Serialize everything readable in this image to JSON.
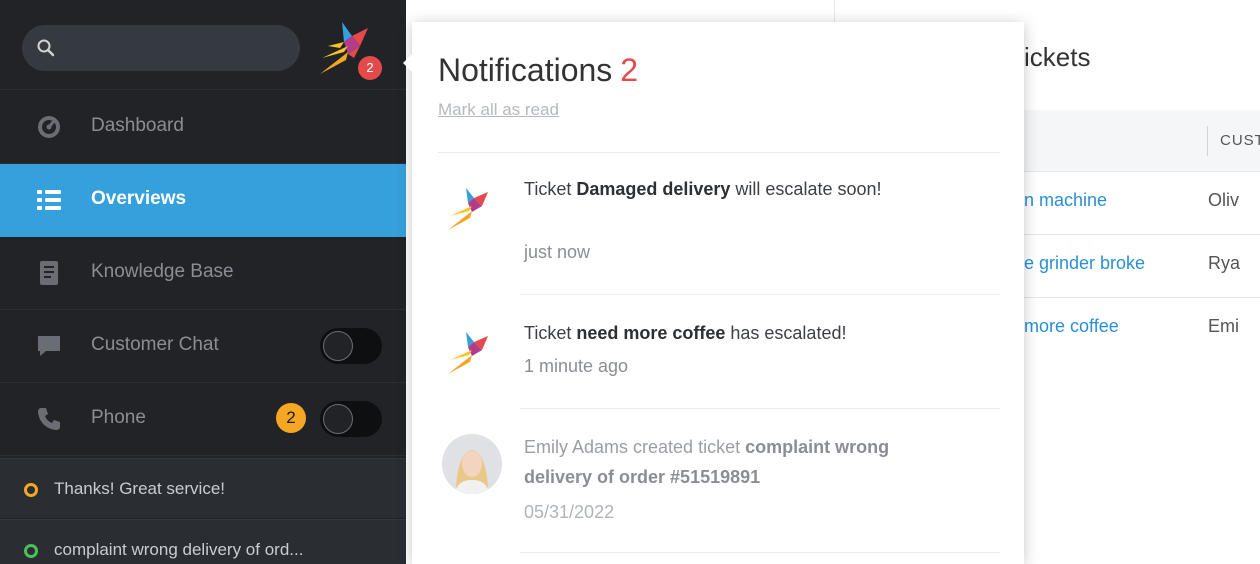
{
  "sidebar": {
    "logo_badge_count": "2",
    "nav": [
      {
        "label": "Dashboard",
        "icon": "dashboard-icon"
      },
      {
        "label": "Overviews",
        "icon": "list-icon",
        "active": true
      },
      {
        "label": "Knowledge Base",
        "icon": "book-icon"
      },
      {
        "label": "Customer Chat",
        "icon": "chat-bubble-icon"
      },
      {
        "label": "Phone",
        "icon": "phone-icon",
        "badge": "2"
      }
    ],
    "chats": [
      {
        "label": "Thanks! Great service!",
        "status_color": "#f5a623"
      },
      {
        "label": "complaint wrong delivery of ord...",
        "status_color": "#4bbf5a"
      }
    ]
  },
  "main": {
    "title": "ickets",
    "table": {
      "column_header": "CUST",
      "rows": [
        {
          "title": "n machine",
          "customer": "Oliv"
        },
        {
          "title": "e grinder broke",
          "customer": "Rya"
        },
        {
          "title": "more coffee",
          "customer": "Emi"
        }
      ]
    }
  },
  "notifications": {
    "title": "Notifications",
    "count": "2",
    "mark_all_read": "Mark all as read",
    "items": [
      {
        "prefix": "Ticket ",
        "bold": "Damaged delivery",
        "suffix": " will escalate soon!",
        "time": "just now",
        "read": false
      },
      {
        "prefix": "Ticket ",
        "bold": "need more coffee",
        "suffix": " has escalated!",
        "time": "1 minute ago",
        "read": false
      },
      {
        "prefix": "Emily Adams created ticket ",
        "bold": "complaint wrong delivery of order #51519891",
        "suffix": "",
        "time": "05/31/2022",
        "read": true
      }
    ]
  },
  "colors": {
    "sidebar_bg": "#212327",
    "active_nav": "#36a0dc",
    "accent_red": "#e54a4a",
    "badge_orange": "#f5a623",
    "link_blue": "#2a8fd6"
  }
}
